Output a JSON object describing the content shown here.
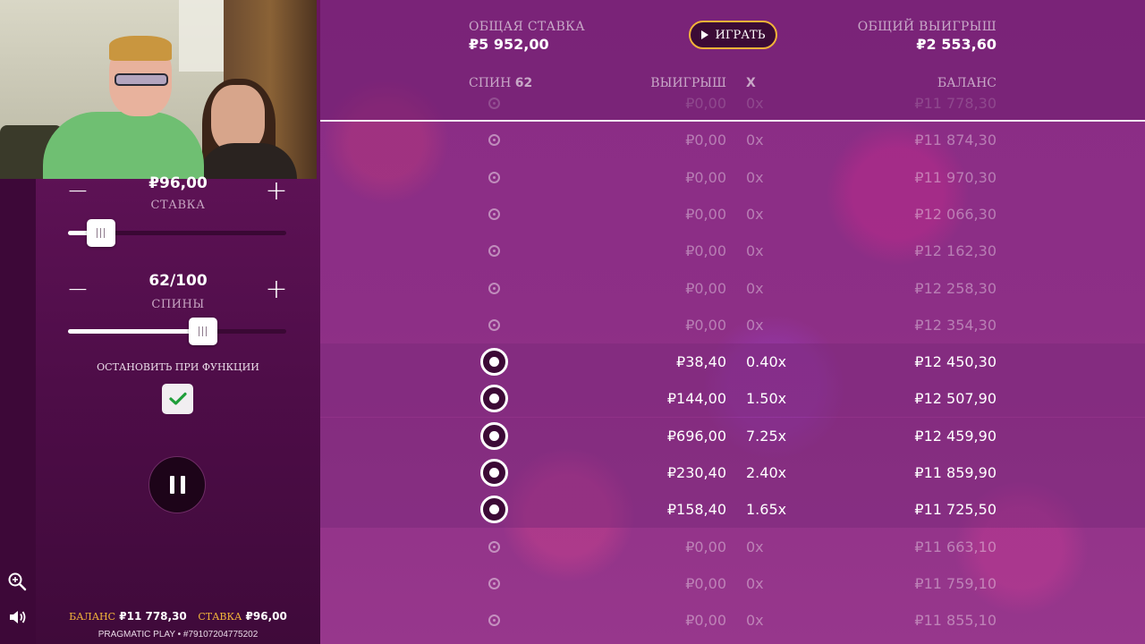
{
  "header": {
    "total_bet_label": "ОБЩАЯ СТАВКА",
    "total_bet_value": "₽5 952,00",
    "play_button_label": "ИГРАТЬ",
    "total_win_label": "ОБЩИЙ ВЫИГРЫШ",
    "total_win_value": "₽2 553,60"
  },
  "columns": {
    "spin_label": "СПИН",
    "spin_count": "62",
    "win": "ВЫИГРЫШ",
    "x": "X",
    "balance": "БАЛАНС"
  },
  "rows": [
    {
      "win": "₽0,00",
      "mult": "0x",
      "balance": "₽11 778,30",
      "active": false
    },
    {
      "win": "₽0,00",
      "mult": "0x",
      "balance": "₽11 874,30",
      "active": false
    },
    {
      "win": "₽0,00",
      "mult": "0x",
      "balance": "₽11 970,30",
      "active": false
    },
    {
      "win": "₽0,00",
      "mult": "0x",
      "balance": "₽12 066,30",
      "active": false
    },
    {
      "win": "₽0,00",
      "mult": "0x",
      "balance": "₽12 162,30",
      "active": false
    },
    {
      "win": "₽0,00",
      "mult": "0x",
      "balance": "₽12 258,30",
      "active": false
    },
    {
      "win": "₽0,00",
      "mult": "0x",
      "balance": "₽12 354,30",
      "active": false
    },
    {
      "win": "₽38,40",
      "mult": "0.40x",
      "balance": "₽12 450,30",
      "active": true
    },
    {
      "win": "₽144,00",
      "mult": "1.50x",
      "balance": "₽12 507,90",
      "active": true
    },
    {
      "win": "₽696,00",
      "mult": "7.25x",
      "balance": "₽12 459,90",
      "active": true
    },
    {
      "win": "₽230,40",
      "mult": "2.40x",
      "balance": "₽11 859,90",
      "active": true
    },
    {
      "win": "₽158,40",
      "mult": "1.65x",
      "balance": "₽11 725,50",
      "active": true
    },
    {
      "win": "₽0,00",
      "mult": "0x",
      "balance": "₽11 663,10",
      "active": false
    },
    {
      "win": "₽0,00",
      "mult": "0x",
      "balance": "₽11 759,10",
      "active": false
    },
    {
      "win": "₽0,00",
      "mult": "0x",
      "balance": "₽11 855,10",
      "active": false
    }
  ],
  "controls": {
    "bet_value": "₽96,00",
    "bet_label": "СТАВКА",
    "bet_slider_fraction": 0.15,
    "spins_value": "62/100",
    "spins_label": "СПИНЫ",
    "spins_slider_fraction": 0.62,
    "stop_on_feature_label": "ОСТАНОВИТЬ ПРИ ФУНКЦИИ",
    "stop_on_feature_checked": true
  },
  "footer": {
    "balance_label": "БАЛАНС",
    "balance_value": "₽11 778,30",
    "bet_label": "СТАВКА",
    "bet_value": "₽96,00",
    "provider": "PRAGMATIC PLAY • #79107204775202"
  },
  "icons": {
    "zoom": "zoom-in-icon",
    "sound": "speaker-icon",
    "pause": "pause-icon",
    "check": "check-icon"
  },
  "colors": {
    "accent_gold": "#f2b338",
    "check_green": "#1f9e3a",
    "panel_purple": "#8a2c85"
  }
}
